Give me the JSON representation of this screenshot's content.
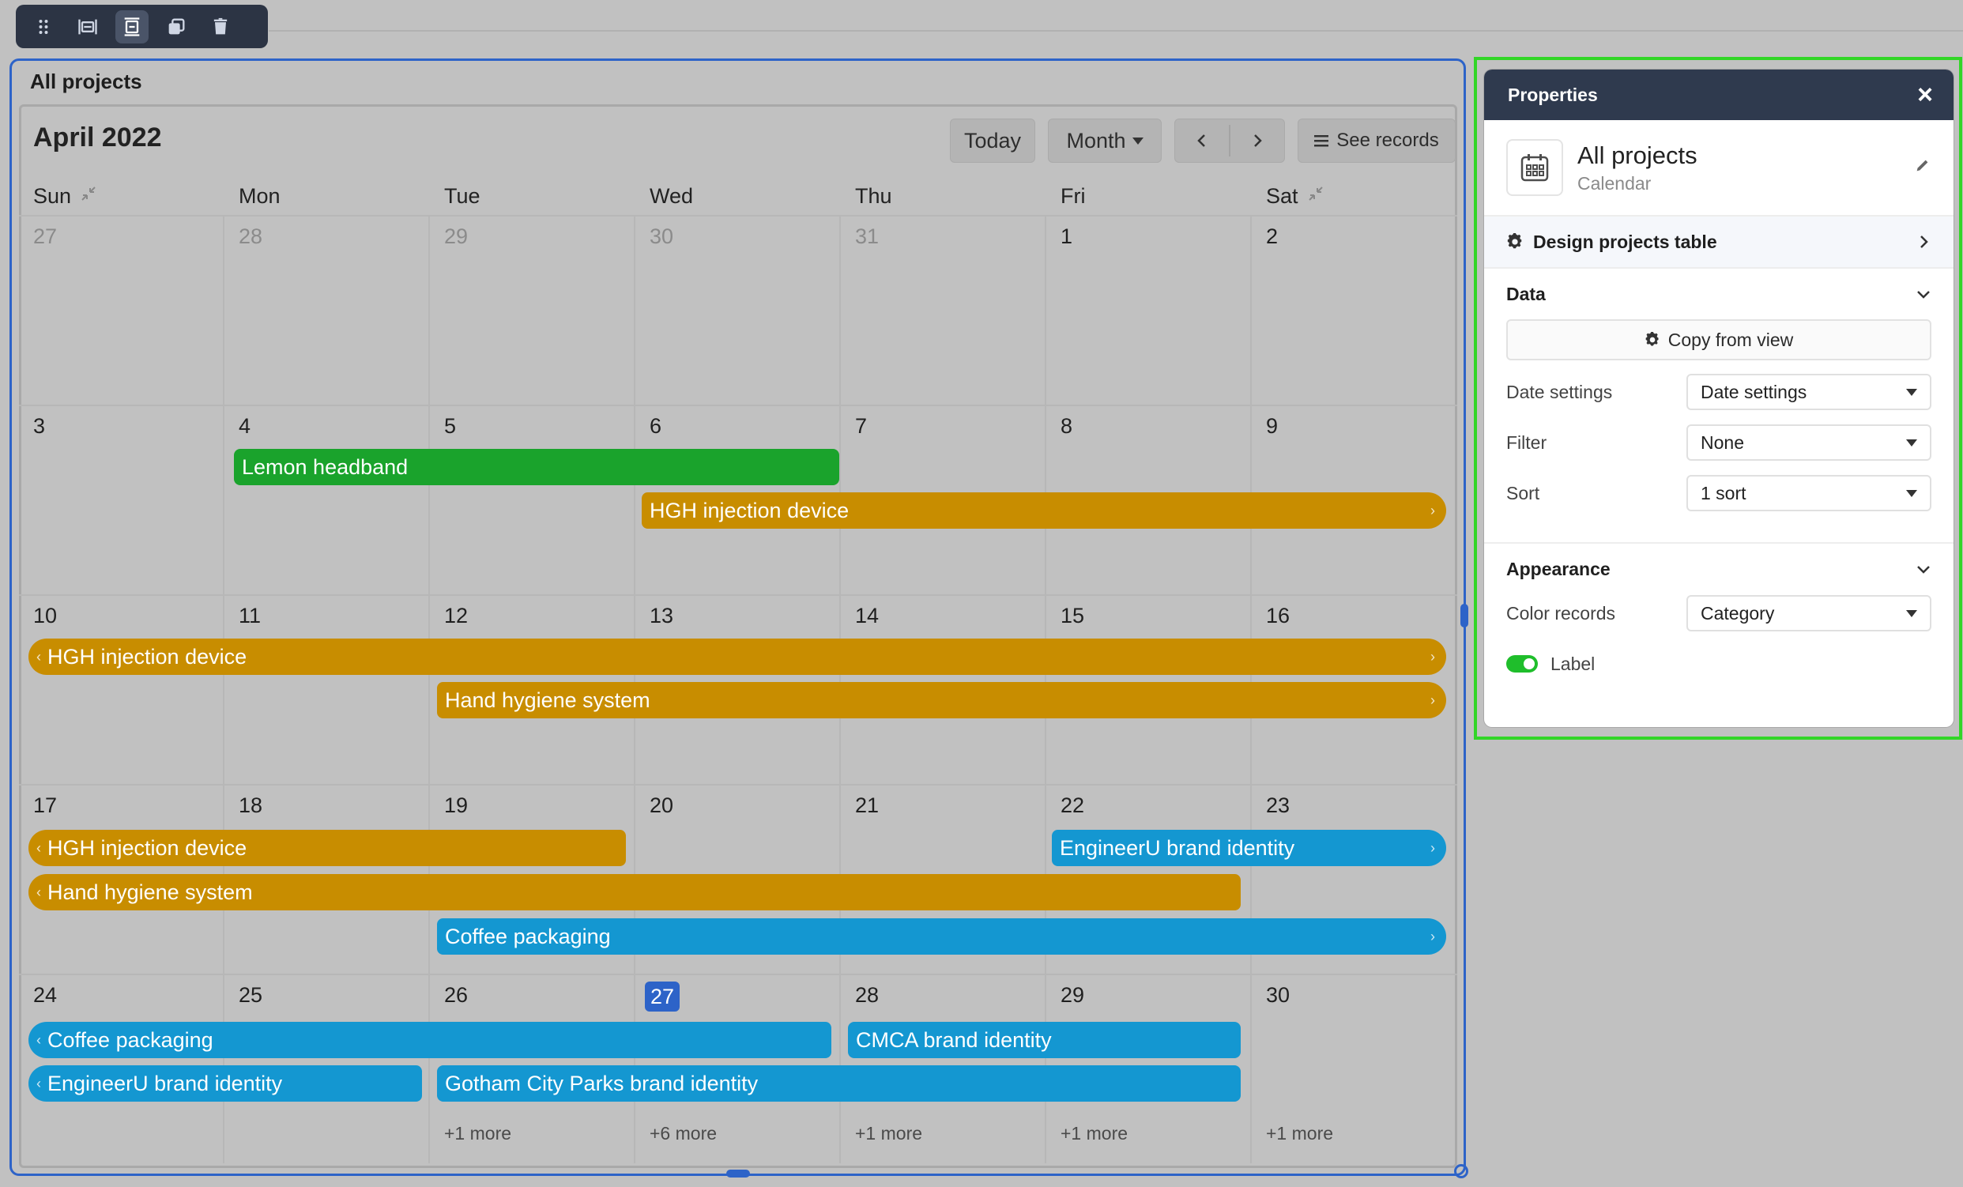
{
  "widget": {
    "title": "All projects"
  },
  "calendar": {
    "month_label": "April 2022",
    "controls": {
      "today": "Today",
      "view": "Month",
      "see_records": "See records"
    },
    "weekdays": [
      "Sun",
      "Mon",
      "Tue",
      "Wed",
      "Thu",
      "Fri",
      "Sat"
    ],
    "weeks": [
      [
        {
          "n": "27",
          "muted": true
        },
        {
          "n": "28",
          "muted": true
        },
        {
          "n": "29",
          "muted": true
        },
        {
          "n": "30",
          "muted": true
        },
        {
          "n": "31",
          "muted": true
        },
        {
          "n": "1"
        },
        {
          "n": "2"
        }
      ],
      [
        {
          "n": "3"
        },
        {
          "n": "4"
        },
        {
          "n": "5"
        },
        {
          "n": "6"
        },
        {
          "n": "7"
        },
        {
          "n": "8"
        },
        {
          "n": "9"
        }
      ],
      [
        {
          "n": "10"
        },
        {
          "n": "11"
        },
        {
          "n": "12"
        },
        {
          "n": "13"
        },
        {
          "n": "14"
        },
        {
          "n": "15"
        },
        {
          "n": "16"
        }
      ],
      [
        {
          "n": "17"
        },
        {
          "n": "18"
        },
        {
          "n": "19"
        },
        {
          "n": "20"
        },
        {
          "n": "21"
        },
        {
          "n": "22"
        },
        {
          "n": "23"
        }
      ],
      [
        {
          "n": "24"
        },
        {
          "n": "25"
        },
        {
          "n": "26",
          "more": "+1 more"
        },
        {
          "n": "27",
          "today": true,
          "more": "+6 more"
        },
        {
          "n": "28",
          "more": "+1 more"
        },
        {
          "n": "29",
          "more": "+1 more"
        },
        {
          "n": "30",
          "more": "+1 more"
        }
      ]
    ],
    "events": [
      {
        "label": "Lemon headband",
        "color": "green"
      },
      {
        "label": "HGH injection device",
        "color": "amber",
        "cont_right": true
      },
      {
        "label": "HGH injection device",
        "color": "amber",
        "cont_left": true,
        "cont_right": true
      },
      {
        "label": "Hand hygiene system",
        "color": "amber",
        "cont_right": true
      },
      {
        "label": "HGH injection device",
        "color": "amber",
        "cont_left": true
      },
      {
        "label": "EngineerU brand identity",
        "color": "cyan",
        "cont_right": true
      },
      {
        "label": "Hand hygiene system",
        "color": "amber",
        "cont_left": true
      },
      {
        "label": "Coffee packaging",
        "color": "cyan",
        "cont_right": true
      },
      {
        "label": "Coffee packaging",
        "color": "cyan",
        "cont_left": true
      },
      {
        "label": "CMCA brand identity",
        "color": "cyan"
      },
      {
        "label": "EngineerU brand identity",
        "color": "cyan",
        "cont_left": true
      },
      {
        "label": "Gotham City Parks brand identity",
        "color": "cyan"
      }
    ]
  },
  "properties": {
    "header": "Properties",
    "name": "All projects",
    "type": "Calendar",
    "design_table": "Design projects table",
    "data": {
      "heading": "Data",
      "copy_from_view": "Copy from view",
      "date_settings_label": "Date settings",
      "date_settings_value": "Date settings",
      "filter_label": "Filter",
      "filter_value": "None",
      "sort_label": "Sort",
      "sort_value": "1 sort"
    },
    "appearance": {
      "heading": "Appearance",
      "color_records_label": "Color records",
      "color_records_value": "Category",
      "label_toggle": "Label"
    }
  },
  "colors": {
    "selection_blue": "#2d63c8",
    "panel_outline_green": "#32d627",
    "event_green": "#1aa32c",
    "event_amber": "#c88d00",
    "event_cyan": "#1497d1"
  }
}
